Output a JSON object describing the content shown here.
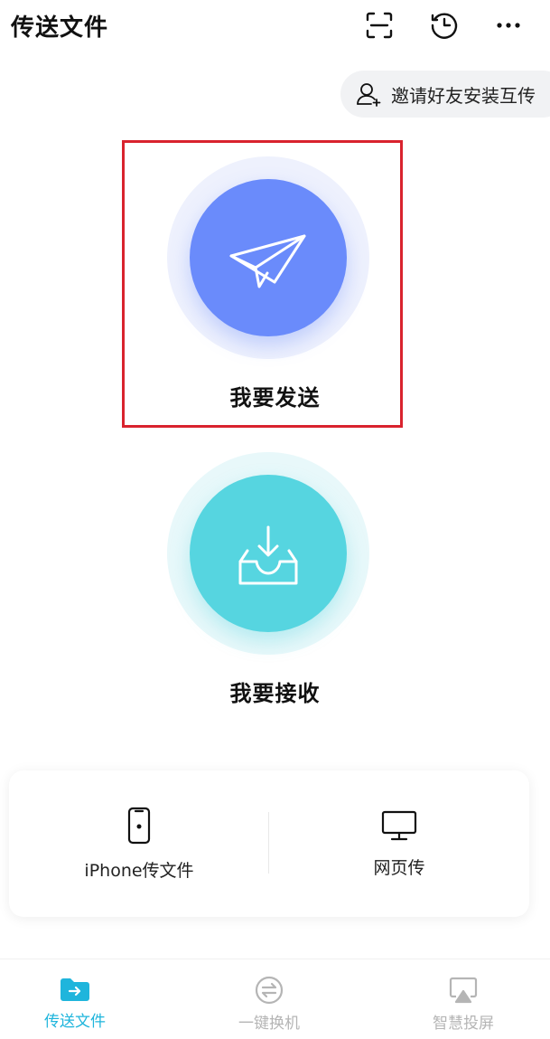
{
  "header": {
    "title": "传送文件",
    "icons": [
      "scan-icon",
      "history-icon",
      "more-icon"
    ]
  },
  "invite": {
    "label": "邀请好友安装互传",
    "icon": "add-user-icon"
  },
  "send": {
    "label": "我要发送",
    "icon": "paper-plane-icon",
    "color": "#6a8bfb"
  },
  "receive": {
    "label": "我要接收",
    "icon": "inbox-download-icon",
    "color": "#56d5e0"
  },
  "card": {
    "items": [
      {
        "label": "iPhone传文件",
        "icon": "iphone-icon"
      },
      {
        "label": "网页传",
        "icon": "monitor-icon"
      }
    ]
  },
  "tabbar": {
    "active_color": "#1fb5dc",
    "inactive_color": "#b5b5b5",
    "tabs": [
      {
        "label": "传送文件",
        "icon": "folder-transfer-icon",
        "active": true
      },
      {
        "label": "一键换机",
        "icon": "swap-icon",
        "active": false
      },
      {
        "label": "智慧投屏",
        "icon": "screen-cast-icon",
        "active": false
      }
    ]
  }
}
